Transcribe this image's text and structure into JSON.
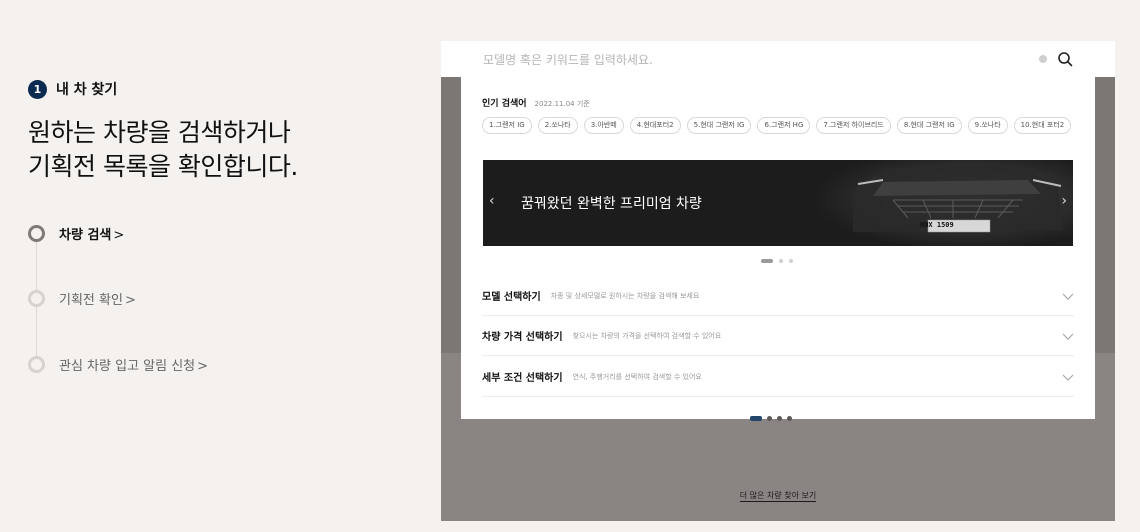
{
  "step": {
    "number": "1",
    "label": "내 차 찾기"
  },
  "headline": {
    "line1": "원하는 차량을 검색하거나",
    "line2": "기획전 목록을 확인합니다."
  },
  "timeline": [
    {
      "label": "차량 검색",
      "chevron": ">",
      "active": true
    },
    {
      "label": "기획전 확인",
      "chevron": ">",
      "active": false
    },
    {
      "label": "관심 차량 입고 알림 신청",
      "chevron": ">",
      "active": false
    }
  ],
  "mockup": {
    "search_placeholder": "모델명 혹은 키워드를 입력하세요.",
    "popular": {
      "title": "인기 검색어",
      "date": "2022.11.04 기준",
      "chips": [
        "1.그랜저 IG",
        "2.쏘나타",
        "3.아반떼",
        "4.현대포터2",
        "5.현대 그랜저 IG",
        "6.그랜저 HG",
        "7.그랜저 하이브리드",
        "8.현대 그랜저 IG",
        "9.쏘나타",
        "10.현대 포터2"
      ]
    },
    "banner": {
      "text": "꿈꿔왔던 완벽한 프리미엄 차량",
      "plate": "HNX 1509",
      "prev": "‹",
      "next": "›"
    },
    "accordion": [
      {
        "title": "모델 선택하기",
        "desc": "차종 및 상세모델로 원하시는 차량을 검색해 보세요"
      },
      {
        "title": "차량 가격 선택하기",
        "desc": "찾으시는 차량의 가격을 선택하여 검색할 수 있어요"
      },
      {
        "title": "세부 조건 선택하기",
        "desc": "연식, 주행거리를 선택하여 검색할 수 있어요"
      }
    ],
    "more_link": "더 많은 차량 찾아 보기"
  },
  "colors": {
    "accent_navy": "#0b2a4f",
    "page_bg": "#f4f1ef",
    "banner_bg": "#1c1c1c"
  },
  "icons": [
    "search-icon",
    "chevron-right-icon",
    "chevron-left-icon",
    "chevron-down-icon"
  ]
}
